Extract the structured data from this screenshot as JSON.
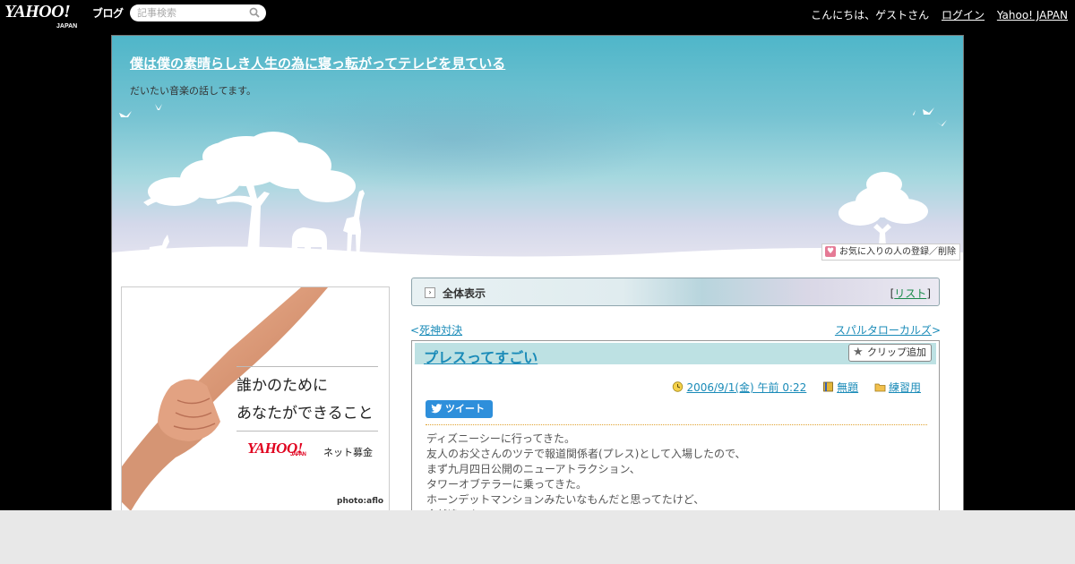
{
  "topbar": {
    "logo_text": "YAHOO!",
    "logo_sub": "JAPAN",
    "logo_blog": "ブログ",
    "search_placeholder": "記事検索",
    "greeting": "こんにちは、ゲストさん",
    "login": "ログイン",
    "yahoo_japan": "Yahoo! JAPAN"
  },
  "header": {
    "title": "僕は僕の素晴らしき人生の為に寝っ転がってテレビを見ている",
    "description": "だいたい音楽の話してます。",
    "favorite_button": "お気に入りの人の登録／削除"
  },
  "ad": {
    "message_line1": "誰かのために",
    "message_line2": "あなたができること",
    "brand": "YAHOO!",
    "brand_sub": "JAPAN",
    "campaign": "ネット募金",
    "credit": "photo:aflo"
  },
  "content": {
    "all_view_label": "全体表示",
    "list_open": "[",
    "list_label": "リスト",
    "list_close": "]",
    "prev_arrow": "<",
    "prev_title": "死神対決",
    "next_title": "スパルタローカルズ",
    "next_arrow": ">"
  },
  "article": {
    "title": "プレスってすごい",
    "clip_button": "クリップ追加",
    "date": "2006/9/1(金) 午前 0:22",
    "theme": "無題",
    "category": "練習用",
    "tweet_button": "ツイート",
    "body_lines": [
      "ディズニーシーに行ってきた。",
      "友人のお父さんのツテで報道関係者(プレス)として入場したので、",
      "まず九月四日公開のニューアトラクション、",
      "タワーオブテラーに乗ってきた。",
      "ホーンデットマンションみたいなもんだと思ってたけど、",
      "全然違った。"
    ]
  },
  "colors": {
    "link": "#1a8bb8",
    "title_bar": "#bde1e3",
    "tweet_blue": "#2e8fdb",
    "page_bg": "#000000"
  }
}
